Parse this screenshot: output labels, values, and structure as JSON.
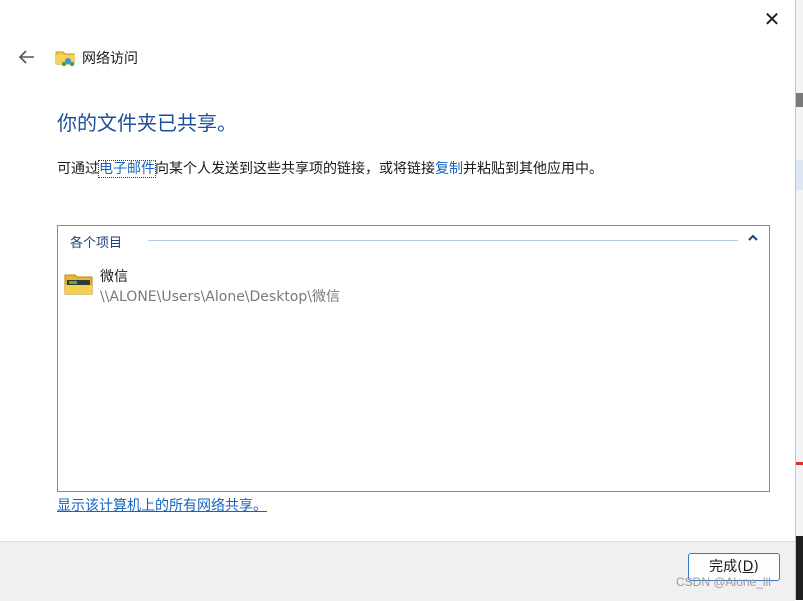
{
  "window": {
    "close_glyph": "✕",
    "back_icon": "back-arrow-icon",
    "title_icon": "network-folder-icon",
    "title": "网络访问"
  },
  "main": {
    "heading": "你的文件夹已共享。",
    "instructions": {
      "prefix": "可通过",
      "email_link": "电子邮件",
      "middle": "向某个人发送到这些共享项的链接，或将链接",
      "copy_link": "复制",
      "suffix": "并粘贴到其他应用中。"
    }
  },
  "list": {
    "group_header": "各个项目",
    "collapse_icon": "chevron-up-icon",
    "items": [
      {
        "icon": "folder-icon",
        "name": "微信",
        "path": "\\\\ALONE\\Users\\Alone\\Desktop\\微信"
      }
    ]
  },
  "show_all_link": "显示该计算机上的所有网络共享。",
  "footer": {
    "finish_label": "完成(",
    "finish_key": "D",
    "finish_label_end": ")"
  },
  "watermark": "CSDN @Alone_lll"
}
